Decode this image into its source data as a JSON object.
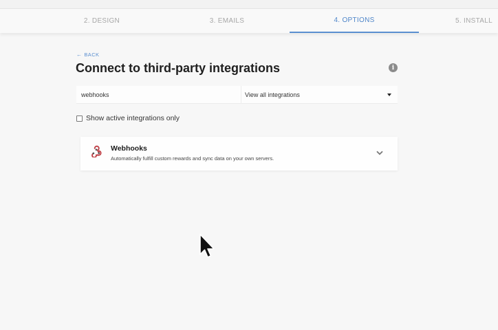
{
  "steps": [
    {
      "label": "2. DESIGN"
    },
    {
      "label": "3. EMAILS"
    },
    {
      "label": "4. OPTIONS"
    },
    {
      "label": "5. INSTALL"
    }
  ],
  "active_step": "4. OPTIONS",
  "back": {
    "label": "BACK",
    "icon": "arrow-left-icon"
  },
  "page": {
    "title": "Connect to third-party integrations"
  },
  "filters": {
    "search_value": "webhooks",
    "select_value": "View all integrations",
    "checkbox_label": "Show active integrations only",
    "checkbox_checked": false
  },
  "integrations": [
    {
      "name": "Webhooks",
      "description": "Automatically fulfill custom rewards and sync data on your own servers.",
      "icon": "webhook-icon",
      "expanded": false
    }
  ],
  "colors": {
    "accent": "#5b8fd0",
    "webhook_icon": "#c1444a"
  }
}
